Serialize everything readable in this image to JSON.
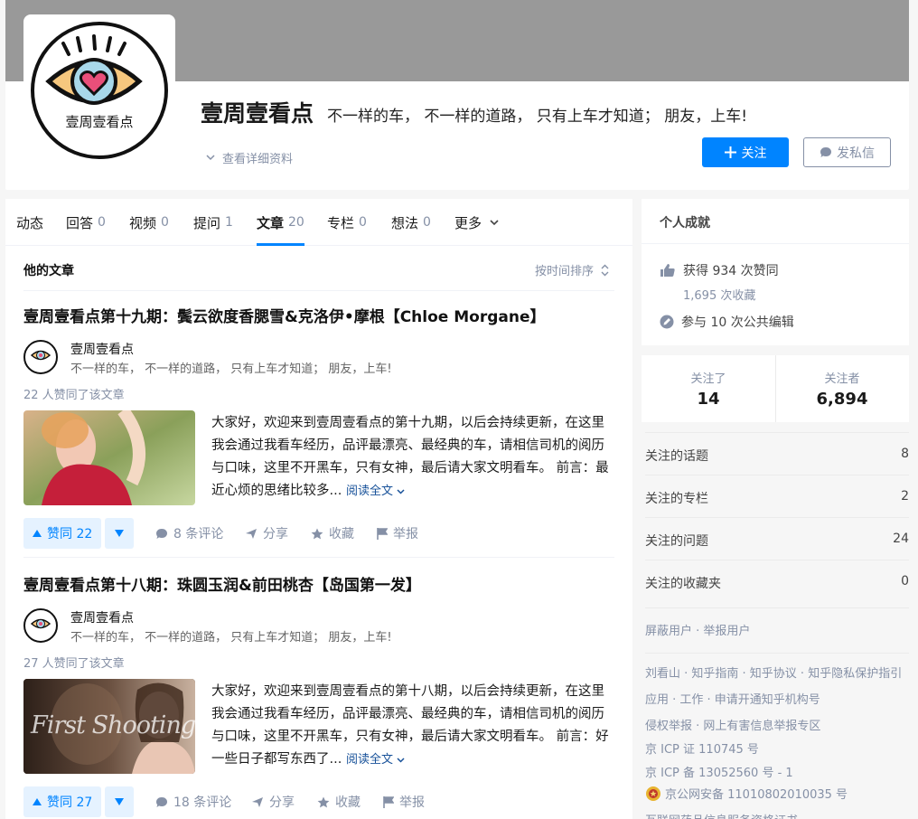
{
  "header": {
    "avatar_text": "壹周壹看点",
    "name": "壹周壹看点",
    "headline": "不一样的车， 不一样的道路， 只有上车才知道； 朋友，上车!",
    "detail_link": "查看详细资料",
    "follow_label": "关注",
    "message_label": "发私信",
    "accent": "#0084ff"
  },
  "tabs": [
    {
      "label": "动态",
      "count": ""
    },
    {
      "label": "回答",
      "count": "0"
    },
    {
      "label": "视频",
      "count": "0"
    },
    {
      "label": "提问",
      "count": "1"
    },
    {
      "label": "文章",
      "count": "20"
    },
    {
      "label": "专栏",
      "count": "0"
    },
    {
      "label": "想法",
      "count": "0"
    },
    {
      "label": "更多",
      "count": ""
    }
  ],
  "list": {
    "title": "他的文章",
    "sort_label": "按时间排序"
  },
  "articles": [
    {
      "title": "壹周壹看点第十九期：鬓云欲度香腮雪&克洛伊•摩根【Chloe Morgane】",
      "author": "壹周壹看点",
      "author_headline": "不一样的车， 不一样的道路， 只有上车才知道； 朋友，上车!",
      "votes_text": "22 人赞同了该文章",
      "excerpt": "大家好，欢迎来到壹周壹看点的第十九期，以后会持续更新，在这里我会通过我看车经历，品评最漂亮、最经典的车，请相信司机的阅历与口味，这里不开黑车，只有女神，最后请大家文明看车。 前言：最近心烦的思绪比较多...",
      "read_more": "阅读全文",
      "upvote": "赞同 22",
      "comments": "8 条评论",
      "share": "分享",
      "collect": "收藏",
      "report": "举报"
    },
    {
      "title": "壹周壹看点第十八期：珠圆玉润&前田桃杏【岛国第一发】",
      "author": "壹周壹看点",
      "author_headline": "不一样的车， 不一样的道路， 只有上车才知道； 朋友，上车!",
      "votes_text": "27 人赞同了该文章",
      "thumb_caption": "First Shooting",
      "excerpt": "大家好，欢迎来到壹周壹看点的第十八期，以后会持续更新，在这里我会通过我看车经历，品评最漂亮、最经典的车，请相信司机的阅历与口味，这里不开黑车，只有女神，最后请大家文明看车。 前言：好一些日子都写东西了...",
      "read_more": "阅读全文",
      "upvote": "赞同 27",
      "comments": "18 条评论",
      "share": "分享",
      "collect": "收藏",
      "report": "举报"
    }
  ],
  "sidebar": {
    "achievement_title": "个人成就",
    "likes": "获得 934 次赞同",
    "collects": "1,695 次收藏",
    "edits": "参与 10 次公共编辑",
    "following_label": "关注了",
    "following_value": "14",
    "followers_label": "关注者",
    "followers_value": "6,894",
    "links": [
      {
        "label": "关注的话题",
        "count": "8"
      },
      {
        "label": "关注的专栏",
        "count": "2"
      },
      {
        "label": "关注的问题",
        "count": "24"
      },
      {
        "label": "关注的收藏夹",
        "count": "0"
      }
    ],
    "block_links": "屏蔽用户 · 举报用户"
  },
  "footer": {
    "line1": "刘看山 · 知乎指南 · 知乎协议 · 知乎隐私保护指引",
    "line2": "应用 · 工作 · 申请开通知乎机构号",
    "line3": "侵权举报 · 网上有害信息举报专区",
    "line4": "京 ICP 证 110745 号",
    "line5": "京 ICP 备 13052560 号 - 1",
    "line6": "京公网安备 11010802010035 号",
    "line7": "互联网药品信息服务资格证书"
  }
}
